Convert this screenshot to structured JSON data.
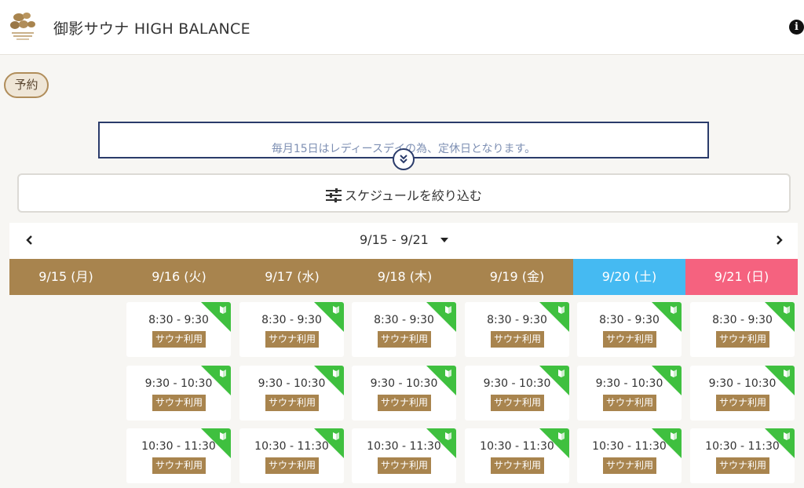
{
  "header": {
    "title": "御影サウナ HIGH BALANCE",
    "logo_icon": "stone-logo-icon",
    "info_icon": "info-icon"
  },
  "tag": {
    "label": "予約"
  },
  "notice": {
    "text": "毎月15日はレディースデイの為、定休日となります。",
    "expand_icon": "double-chevron-down-icon"
  },
  "filter": {
    "label": "スケジュールを絞り込む",
    "icon": "sliders-icon"
  },
  "week": {
    "range": "9/15 - 9/21",
    "prev_icon": "chevron-left-icon",
    "next_icon": "chevron-right-icon",
    "dropdown_icon": "caret-down-icon"
  },
  "colors": {
    "weekday": "#a8844e",
    "saturday": "#45baf2",
    "sunday": "#f5627f",
    "corner": "#3fc03f",
    "badge": "#a8844e"
  },
  "days": [
    {
      "label": "9/15 (月)",
      "type": "weekday"
    },
    {
      "label": "9/16 (火)",
      "type": "weekday"
    },
    {
      "label": "9/17 (水)",
      "type": "weekday"
    },
    {
      "label": "9/18 (木)",
      "type": "weekday"
    },
    {
      "label": "9/19 (金)",
      "type": "weekday"
    },
    {
      "label": "9/20 (土)",
      "type": "saturday"
    },
    {
      "label": "9/21 (日)",
      "type": "sunday"
    }
  ],
  "slots": {
    "times": [
      "8:30 - 9:30",
      "9:30 - 10:30",
      "10:30 - 11:30"
    ],
    "badge": "サウナ利用",
    "corner_icon": "beginner-mark-icon"
  }
}
